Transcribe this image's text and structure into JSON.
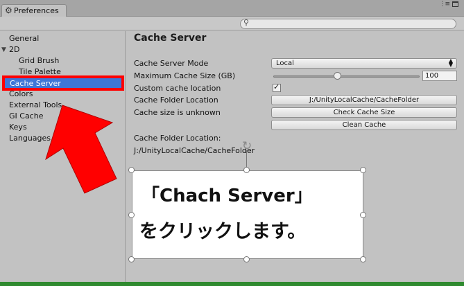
{
  "window": {
    "tab_title": "Preferences",
    "menu_glyph": "⋮≡"
  },
  "search": {
    "placeholder": "",
    "value": ""
  },
  "sidebar": {
    "items": [
      {
        "label": "General"
      },
      {
        "label": "2D"
      },
      {
        "label": "Grid Brush"
      },
      {
        "label": "Tile Palette"
      },
      {
        "label": "Cache Server"
      },
      {
        "label": "Colors"
      },
      {
        "label": "External Tools"
      },
      {
        "label": "GI Cache"
      },
      {
        "label": "Keys"
      },
      {
        "label": "Languages"
      }
    ],
    "selected": "Cache Server"
  },
  "page": {
    "title": "Cache Server",
    "mode_label": "Cache Server Mode",
    "mode_value": "Local",
    "max_size_label": "Maximum Cache Size (GB)",
    "max_size_value": "100",
    "max_size_fraction": 0.44,
    "custom_label": "Custom cache location",
    "custom_checked": true,
    "folder_label": "Cache Folder Location",
    "folder_button": "J:/UnityLocalCache/CacheFolder",
    "size_unknown_label": "Cache size is unknown",
    "check_button": "Check Cache Size",
    "clean_button": "Clean Cache",
    "folder_location_heading": "Cache Folder Location:",
    "folder_location_value": "J:/UnityLocalCache/CacheFolder"
  },
  "annotation": {
    "line1": "「Chach Server」",
    "line2": "をクリックします。",
    "highlight_color": "#ff0000",
    "arrow_color": "#ff0000"
  },
  "colors": {
    "selection": "#3f76d6",
    "window_bg": "#c2c2c2"
  }
}
